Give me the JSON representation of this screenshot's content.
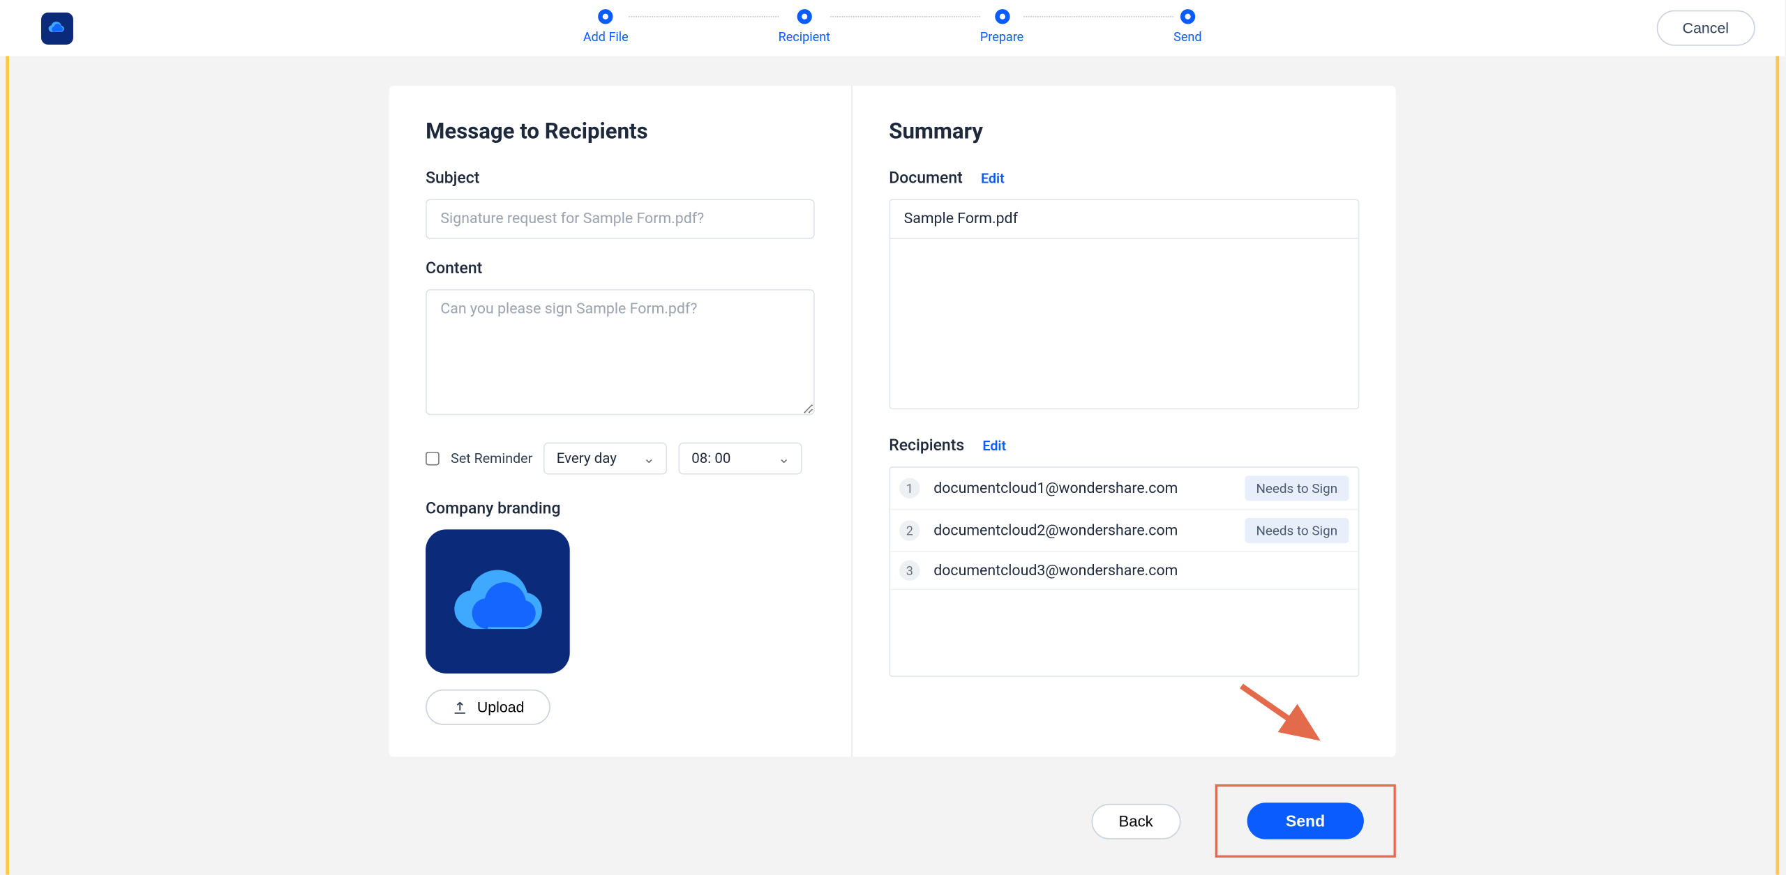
{
  "header": {
    "cancel": "Cancel",
    "steps": [
      "Add File",
      "Recipient",
      "Prepare",
      "Send"
    ]
  },
  "left": {
    "title": "Message to Recipients",
    "subject_label": "Subject",
    "subject_placeholder": "Signature request for Sample Form.pdf?",
    "content_label": "Content",
    "content_placeholder": "Can you please sign Sample Form.pdf?",
    "reminder_label": "Set Reminder",
    "reminder_freq": "Every day",
    "reminder_time": "08: 00",
    "branding_label": "Company branding",
    "upload": "Upload"
  },
  "right": {
    "title": "Summary",
    "document_label": "Document",
    "edit": "Edit",
    "document_name": "Sample Form.pdf",
    "recipients_label": "Recipients",
    "recipients": [
      {
        "num": "1",
        "email": "documentcloud1@wondershare.com",
        "badge": "Needs to Sign"
      },
      {
        "num": "2",
        "email": "documentcloud2@wondershare.com",
        "badge": "Needs to Sign"
      },
      {
        "num": "3",
        "email": "documentcloud3@wondershare.com",
        "badge": ""
      }
    ]
  },
  "footer": {
    "back": "Back",
    "send": "Send"
  }
}
